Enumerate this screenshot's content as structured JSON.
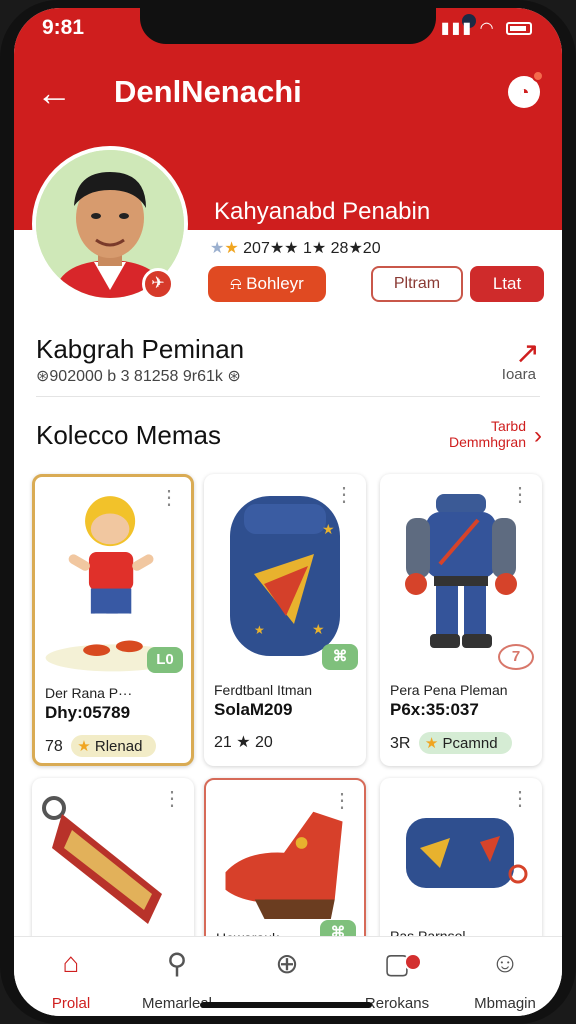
{
  "status": {
    "time": "9:81"
  },
  "header": {
    "title": "DenlNenachi"
  },
  "profile": {
    "name": "Kahyanabd Penabin",
    "stats": "207★★ 1★ 28★20",
    "follow_label": "Bohleyr",
    "btn_outline_label": "Pltram",
    "btn_red_label": "Ltat"
  },
  "section": {
    "title": "Kabgrah Peminan",
    "subtitle": "⊛902000 b 3 81258 9r61k ⊛",
    "link_label": "Ioara"
  },
  "collection": {
    "title": "Kolecco Memas",
    "link_line1": "Tarbd",
    "link_line2": "Demmhgran"
  },
  "cards": [
    {
      "name": "Der Rana P···",
      "code": "Dhy:05789",
      "count": "78",
      "pill": "Rlenad",
      "tag": "L0"
    },
    {
      "name": "Ferdtbanl Itman",
      "code": "SolaM209",
      "count": "21 ★ 20",
      "pill": "",
      "tag": "⌘"
    },
    {
      "name": "Pera Pena Pleman",
      "code": "P6x:35:037",
      "count": "3R",
      "pill": "Pcamnd",
      "tag": "7"
    },
    {
      "name": "",
      "code": "",
      "count": "",
      "pill": "",
      "tag": ""
    },
    {
      "name": "Hewarauk",
      "code": "",
      "count": "",
      "pill": "",
      "tag": "⌘"
    },
    {
      "name": "Pas Parnsol",
      "code": "",
      "count": "",
      "pill": "",
      "tag": ""
    }
  ],
  "tabs": [
    {
      "label": "Prolal"
    },
    {
      "label": "Memarleal"
    },
    {
      "label": ""
    },
    {
      "label": "Rerokans"
    },
    {
      "label": "Mbmagin"
    }
  ]
}
